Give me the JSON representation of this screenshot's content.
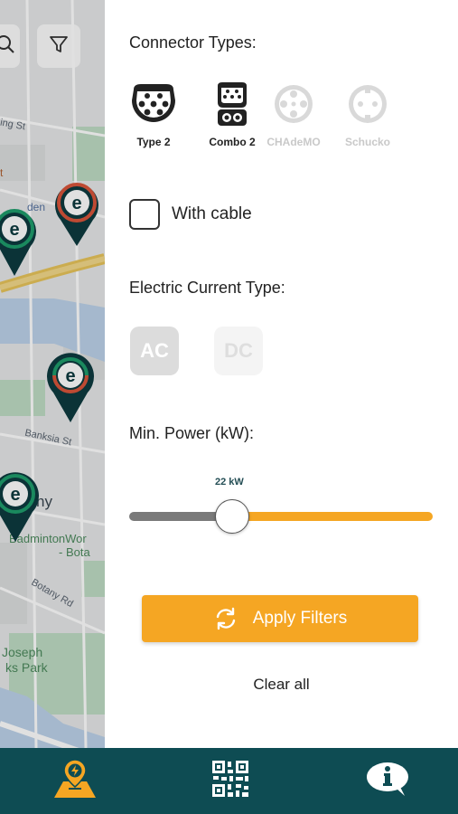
{
  "map": {
    "street_labels": [
      "ing St",
      "Banksia St",
      "Botany Rd",
      "Joseph",
      "ks Park",
      "BadmintonWor",
      "- Bota",
      "ny",
      "den",
      "t"
    ]
  },
  "panel": {
    "connector_title": "Connector Types:",
    "connectors": [
      {
        "label": "Type 2",
        "icon": "type2-connector-icon",
        "active": true
      },
      {
        "label": "Combo 2",
        "icon": "combo2-connector-icon",
        "active": true
      },
      {
        "label": "CHAdeMO",
        "icon": "chademo-connector-icon",
        "active": false
      },
      {
        "label": "Schucko",
        "icon": "schuko-connector-icon",
        "active": false
      }
    ],
    "with_cable_label": "With cable",
    "current_title": "Electric Current Type:",
    "current_ac": "AC",
    "current_dc": "DC",
    "power_title": "Min. Power (kW):",
    "power_value": "22 kW",
    "apply_label": "Apply Filters",
    "clear_label": "Clear all"
  },
  "colors": {
    "accent": "#f5a623",
    "nav_bg": "#0e4c53",
    "pin_dark": "#0d3b3f",
    "pin_ring_green": "#1e9c6b",
    "pin_ring_red": "#d9553b"
  },
  "nav": [
    "map-charging-icon",
    "qr-code-icon",
    "info-chat-icon"
  ]
}
